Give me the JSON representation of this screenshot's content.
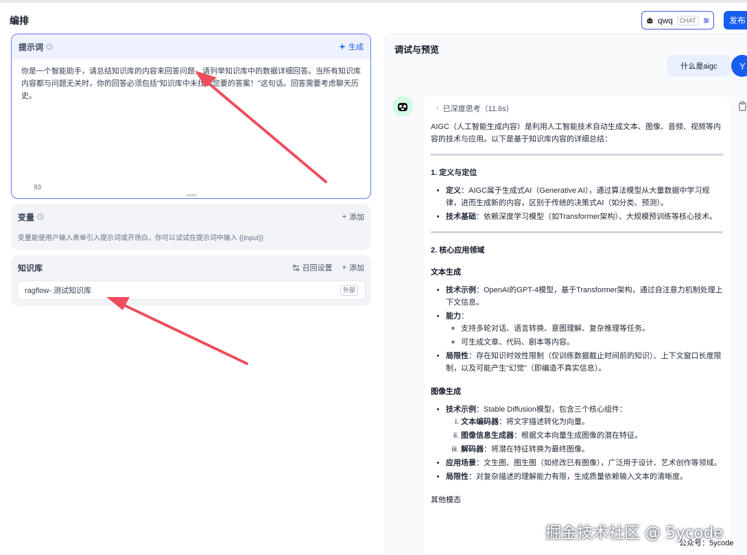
{
  "header": {
    "title": "编排",
    "model_name": "qwq",
    "model_badge": "CHAT",
    "publish_label": "发布"
  },
  "prompt": {
    "title": "提示词",
    "generate_label": "生成",
    "text": "你是一个智能助手，请总结知识库的内容来回答问题，请列举知识库中的数据详细回答。当所有知识库内容都与问题无关时，你的回答必须包括\"知识库中未找到您要的答案！\"这句话。回答需要考虑聊天历史。",
    "char_count": "93"
  },
  "variables": {
    "title": "变量",
    "add_label": "添加",
    "description": "变量能使用户输入表单引入提示词或开场白，你可以试试在提示词中输入 {{input}}"
  },
  "knowledge": {
    "title": "知识库",
    "recall_label": "召回设置",
    "add_label": "添加",
    "item_name": "ragflow- 测试知识库",
    "item_tag": "外部"
  },
  "preview": {
    "title": "调试与预览",
    "user_message": "什么是aigc",
    "user_initial": "Y",
    "thinking_label": "已深度思考（11.6s）",
    "intro": "AIGC（人工智能生成内容）是利用人工智能技术自动生成文本、图像、音频、视频等内容的技术与应用。以下是基于知识库内容的详细总结：",
    "s1_title": "1. 定义与定位",
    "s1_items": [
      {
        "k": "定义",
        "v": "：AIGC属于生成式AI（Generative AI），通过算法模型从大量数据中学习规律，进而生成新的内容，区别于传统的决策式AI（如分类、预测）。"
      },
      {
        "k": "技术基础",
        "v": "：依赖深度学习模型（如Transformer架构）、大规模预训练等核心技术。"
      }
    ],
    "s2_title": "2. 核心应用领域",
    "text_gen_title": "文本生成",
    "text_gen": {
      "example_k": "技术示例",
      "example_v": "：OpenAI的GPT-4模型，基于Transformer架构，通过自注意力机制处理上下文信息。",
      "ability_k": "能力",
      "ability_v": "：",
      "abilities": [
        "支持多轮对话、语言转换、意图理解、复杂推理等任务。",
        "可生成文章、代码、剧本等内容。"
      ],
      "limit_k": "局限性",
      "limit_v": "：存在知识时效性限制（仅训练数据截止时间前的知识）、上下文窗口长度限制，以及可能产生\"幻觉\"（即编造不真实信息）。"
    },
    "image_gen_title": "图像生成",
    "image_gen": {
      "example_k": "技术示例",
      "example_v": "：Stable Diffusion模型，包含三个核心组件：",
      "components": [
        {
          "k": "文本编码器",
          "v": "：将文字描述转化为向量。"
        },
        {
          "k": "图像信息生成器",
          "v": "：根据文本向量生成图像的潜在特征。"
        },
        {
          "k": "解码器",
          "v": "：将潜在特征转换为最终图像。"
        }
      ],
      "scene_k": "应用场景",
      "scene_v": "：文生图、图生图（如修改已有图像），广泛用于设计、艺术创作等领域。",
      "limit_k": "局限性",
      "limit_v": "：对复杂描述的理解能力有限，生成质量依赖输入文本的清晰度。"
    },
    "other_title": "其他模态"
  },
  "watermark": {
    "main": "掘金技术社区 @ 5ycode",
    "sub": "公众号：5ycode"
  },
  "colors": {
    "accent": "#155eef",
    "arrow": "#ef4d5b"
  }
}
